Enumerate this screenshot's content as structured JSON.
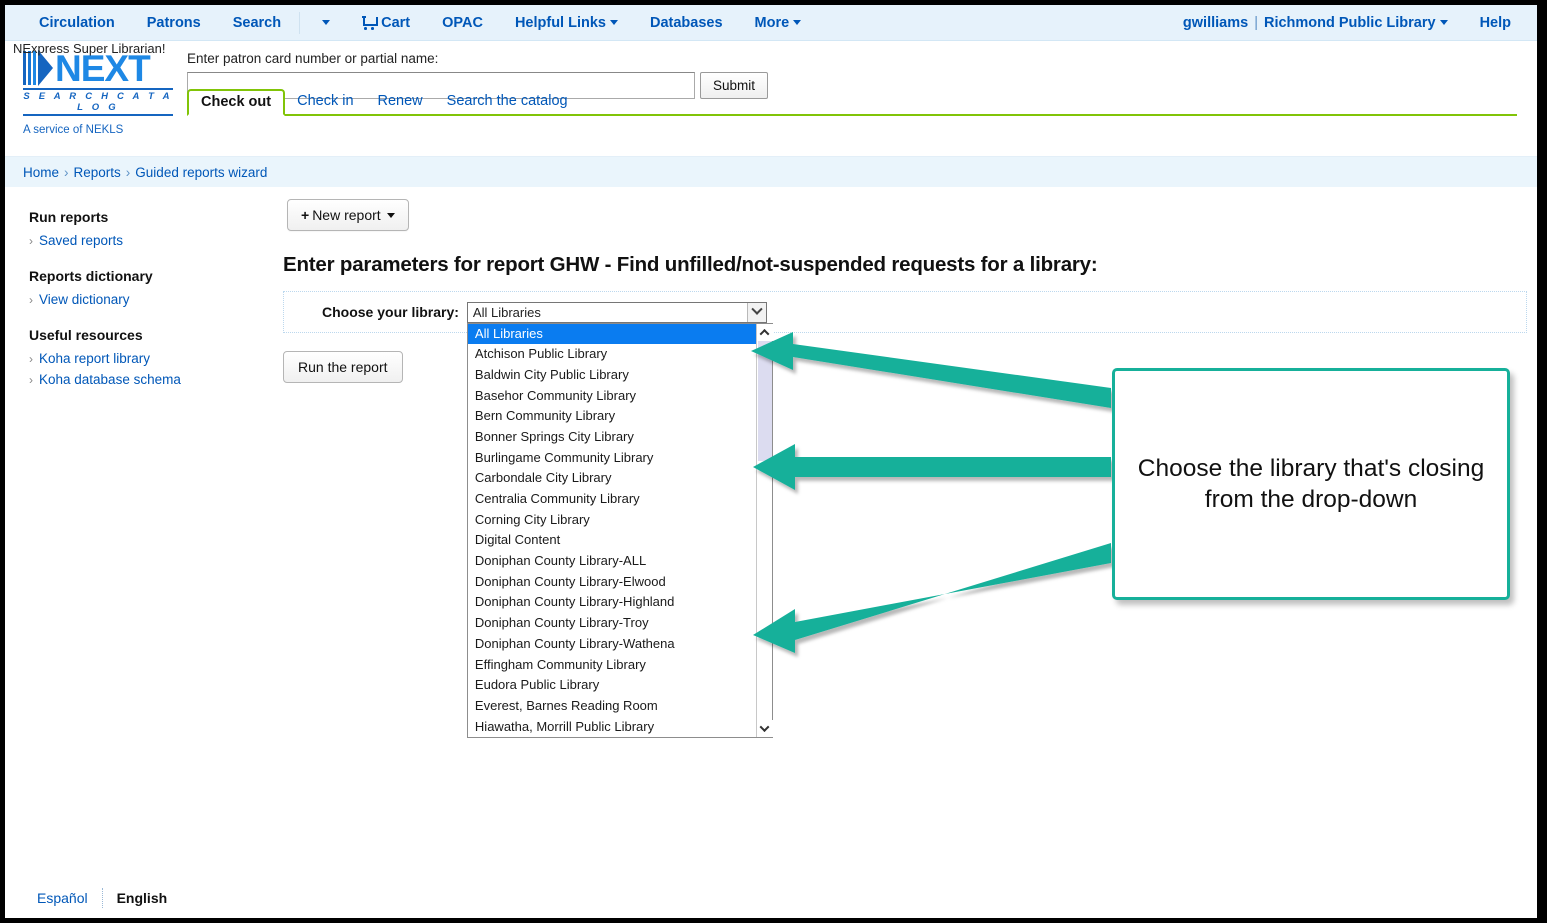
{
  "navbar": {
    "left_items": [
      {
        "label": "Circulation",
        "icon": null,
        "caret": false
      },
      {
        "label": "Patrons",
        "icon": null,
        "caret": false
      },
      {
        "label": "Search",
        "icon": null,
        "caret": false
      }
    ],
    "divider_caret": "chevron-down-icon",
    "cart": {
      "label": "Cart",
      "icon": "cart-icon"
    },
    "right_of_cart": [
      {
        "label": "OPAC",
        "caret": false
      },
      {
        "label": "Helpful Links",
        "caret": true
      },
      {
        "label": "Databases",
        "caret": false
      },
      {
        "label": "More",
        "caret": true
      }
    ],
    "user": "gwilliams",
    "pipe": "|",
    "library": "Richmond Public Library",
    "help": "Help"
  },
  "super_librarian": "NExpress Super Librarian!",
  "logo": {
    "word": "NEXT",
    "tagline": "S E A R C H   C A T A L O G",
    "service": "A service of NEKLS"
  },
  "patron_search": {
    "label": "Enter patron card number or partial name:",
    "value": "",
    "placeholder": "",
    "submit_label": "Submit"
  },
  "tabs": {
    "active": "Check out",
    "items": [
      "Check out",
      "Check in",
      "Renew",
      "Search the catalog"
    ]
  },
  "breadcrumb": {
    "items": [
      "Home",
      "Reports",
      "Guided reports wizard"
    ],
    "separator": "›"
  },
  "sidebar": {
    "sections": [
      {
        "heading": "Run reports",
        "links": [
          "Saved reports"
        ]
      },
      {
        "heading": "Reports dictionary",
        "links": [
          "View dictionary"
        ]
      },
      {
        "heading": "Useful resources",
        "links": [
          "Koha report library",
          "Koha database schema"
        ]
      }
    ],
    "chevron": "›"
  },
  "content": {
    "new_report_label": "New report",
    "new_report_plus": "➕",
    "heading": "Enter parameters for report GHW - Find unfilled/not-suspended requests for a library:",
    "param_label": "Choose your library:",
    "run_report_label": "Run the report"
  },
  "library_select": {
    "selected": "All Libraries",
    "options": [
      "All Libraries",
      "Atchison Public Library",
      "Baldwin City Public Library",
      "Basehor Community Library",
      "Bern Community Library",
      "Bonner Springs City Library",
      "Burlingame Community Library",
      "Carbondale City Library",
      "Centralia Community Library",
      "Corning City Library",
      "Digital Content",
      "Doniphan County Library-ALL",
      "Doniphan County Library-Elwood",
      "Doniphan County Library-Highland",
      "Doniphan County Library-Troy",
      "Doniphan County Library-Wathena",
      "Effingham Community Library",
      "Eudora Public Library",
      "Everest, Barnes Reading Room",
      "Hiawatha, Morrill Public Library"
    ]
  },
  "annotation": {
    "callout_text": "Choose the library that's closing from the drop-down",
    "arrow_count": 3,
    "accent_color": "#16b09a"
  },
  "footer": {
    "spanish": "Español",
    "english": "English"
  },
  "colors": {
    "nav_bg": "#e6f2fb",
    "link_blue": "#0057b8",
    "breadcrumb_bg": "#eaf5fc",
    "tab_green": "#81c408",
    "select_highlight": "#0a7cf0",
    "teal_accent": "#16b09a"
  }
}
